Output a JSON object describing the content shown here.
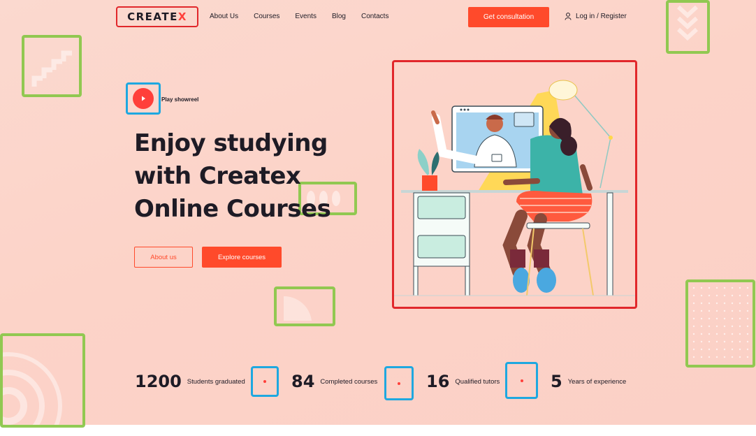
{
  "header": {
    "logo_main": "CREATE",
    "logo_accent": "X",
    "nav": [
      "About Us",
      "Courses",
      "Events",
      "Blog",
      "Contacts"
    ],
    "cta_label": "Get consultation",
    "login_label": "Log in / Register"
  },
  "hero": {
    "play_label": "Play showreel",
    "title_line1": "Enjoy studying",
    "title_line2": "with Createx",
    "title_line3": "Online Courses",
    "btn_about": "About us",
    "btn_explore": "Explore courses"
  },
  "stats": [
    {
      "number": "1200",
      "label": "Students graduated"
    },
    {
      "number": "84",
      "label": "Completed courses"
    },
    {
      "number": "16",
      "label": "Qualified tutors"
    },
    {
      "number": "5",
      "label": "Years of experience"
    }
  ],
  "colors": {
    "accent": "#ff4a2b",
    "annotation_red": "#e1272b",
    "annotation_blue": "#1ea8e0",
    "annotation_green": "#8cc84b"
  },
  "icons": {
    "play": "play-icon",
    "user": "user-icon"
  }
}
